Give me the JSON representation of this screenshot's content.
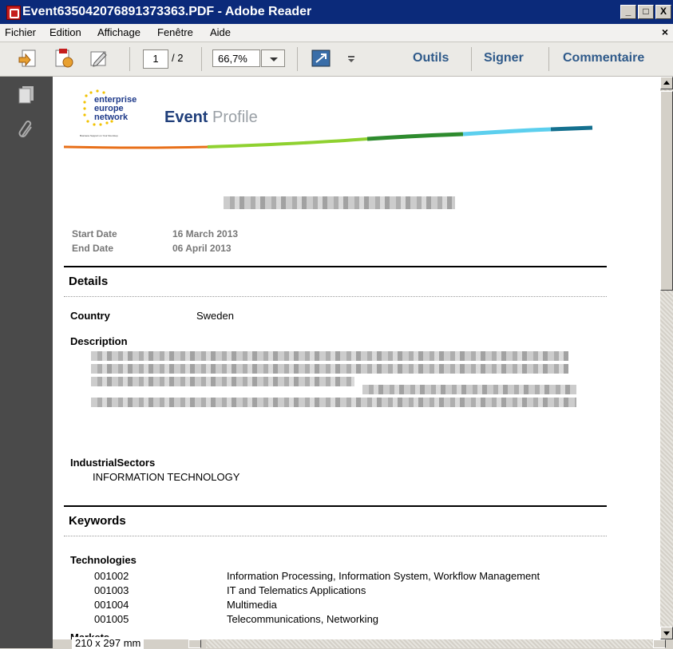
{
  "window": {
    "title": "Event635042076891373363.PDF - Adobe Reader",
    "buttons": [
      "_",
      "□",
      "X"
    ]
  },
  "menu": {
    "items": [
      "Fichier",
      "Edition",
      "Affichage",
      "Fenêtre",
      "Aide"
    ],
    "close": "×"
  },
  "toolbar": {
    "page_current": "1",
    "page_total": "/ 2",
    "zoom": "66,7%",
    "links": [
      "Outils",
      "Signer",
      "Commentaire"
    ],
    "icons": [
      "create-pdf-icon",
      "export-icon",
      "sign-pen-icon",
      "fit-page-icon",
      "more-icon"
    ]
  },
  "leftpanel": {
    "icons": [
      "pages-icon",
      "attachments-icon"
    ]
  },
  "document": {
    "logo_lines": [
      "enterprise",
      "europe",
      "network"
    ],
    "logo_tagline": "Business Support on Your Doorstep",
    "header_bold": "Event",
    "header_light": "Profile",
    "start_date_label": "Start Date",
    "start_date_value": "16 March 2013",
    "end_date_label": "End Date",
    "end_date_value": "06 April 2013",
    "details_heading": "Details",
    "country_label": "Country",
    "country_value": "Sweden",
    "description_label": "Description",
    "industrial_label": "IndustrialSectors",
    "industrial_value": "INFORMATION TECHNOLOGY",
    "keywords_heading": "Keywords",
    "technologies_label": "Technologies",
    "technologies": [
      {
        "code": "001002",
        "name": "Information Processing, Information System, Workflow Management"
      },
      {
        "code": "001003",
        "name": "IT and Telematics Applications"
      },
      {
        "code": "001004",
        "name": "Multimedia"
      },
      {
        "code": "001005",
        "name": "Telecommunications, Networking"
      }
    ],
    "markets_label": "Markets"
  },
  "status": {
    "page_size": "210 x 297 mm"
  },
  "colors": {
    "title_bar": "#0b2a7a",
    "link": "#2f5a8a",
    "event_blue": "#1f3e7a"
  }
}
